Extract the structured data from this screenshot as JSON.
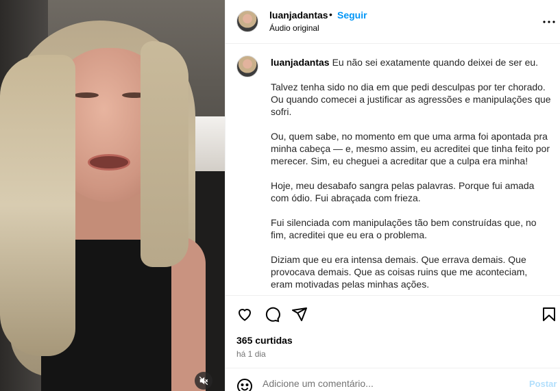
{
  "post": {
    "username": "luanjadantas",
    "separator": "•",
    "follow_label": "Seguir",
    "audio_label": "Áudio original",
    "more_icon": "more-horizontal-icon"
  },
  "caption": {
    "username": "luanjadantas",
    "paragraphs": [
      "Eu não sei exatamente quando deixei de ser eu.",
      "Talvez tenha sido no dia em que pedi desculpas por ter chorado. Ou quando comecei a justificar as agressões e manipulações que sofri.",
      "Ou, quem sabe, no momento em que uma arma foi apontada pra minha cabeça — e, mesmo assim, eu acreditei que tinha feito por merecer. Sim, eu cheguei a acreditar que a culpa era minha!",
      "Hoje, meu desabafo sangra pelas palavras. Porque fui amada com ódio. Fui abraçada com frieza.",
      "Fui silenciada com manipulações tão bem construídas que, no fim, acreditei que eu era o problema.",
      "Diziam que eu era intensa demais. Que errava demais. Que provocava demais. Que as coisas ruins que me aconteciam, eram motivadas pelas minhas ações."
    ]
  },
  "actions": {
    "likes": "365 curtidas",
    "time": "há 1 dia",
    "icons": [
      "heart-icon",
      "comment-icon",
      "share-icon",
      "bookmark-icon"
    ]
  },
  "comment": {
    "placeholder": "Adicione um comentário...",
    "post_label": "Postar"
  },
  "media": {
    "mute_icon": "muted-speaker-icon"
  }
}
